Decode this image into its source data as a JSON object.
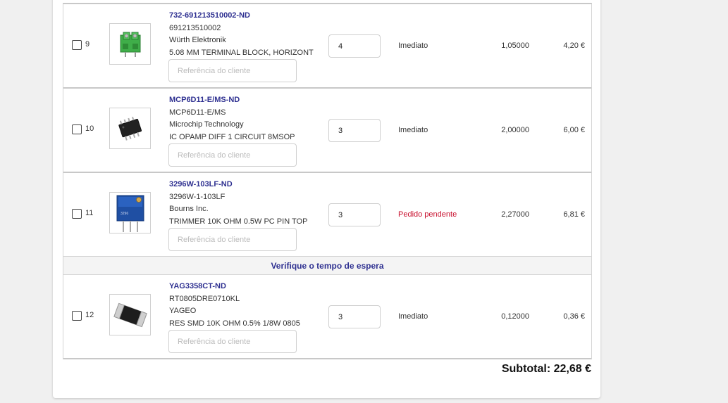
{
  "items": [
    {
      "line": "9",
      "part_number": "732-691213510002-ND",
      "mfr_part": "691213510002",
      "manufacturer": "Würth Elektronik",
      "description": "5.08 MM TERMINAL BLOCK, HORIZONT",
      "ref_placeholder": "Referência do cliente",
      "quantity": "4",
      "availability": "Imediato",
      "availability_status": "immediate",
      "unit_price": "1,05000",
      "ext_price": "4,20 €",
      "image_icon": "terminal-block-icon"
    },
    {
      "line": "10",
      "part_number": "MCP6D11-E/MS-ND",
      "mfr_part": "MCP6D11-E/MS",
      "manufacturer": "Microchip Technology",
      "description": "IC OPAMP DIFF 1 CIRCUIT 8MSOP",
      "ref_placeholder": "Referência do cliente",
      "quantity": "3",
      "availability": "Imediato",
      "availability_status": "immediate",
      "unit_price": "2,00000",
      "ext_price": "6,00 €",
      "image_icon": "ic-chip-icon"
    },
    {
      "line": "11",
      "part_number": "3296W-103LF-ND",
      "mfr_part": "3296W-1-103LF",
      "manufacturer": "Bourns Inc.",
      "description": "TRIMMER 10K OHM 0.5W PC PIN TOP",
      "ref_placeholder": "Referência do cliente",
      "quantity": "3",
      "availability": "Pedido pendente",
      "availability_status": "pending",
      "unit_price": "2,27000",
      "ext_price": "6,81 €",
      "image_icon": "trimmer-potentiometer-icon"
    },
    {
      "line": "12",
      "part_number": "YAG3358CT-ND",
      "mfr_part": "RT0805DRE0710KL",
      "manufacturer": "YAGEO",
      "description": "RES SMD 10K OHM 0.5% 1/8W 0805",
      "ref_placeholder": "Referência do cliente",
      "quantity": "3",
      "availability": "Imediato",
      "availability_status": "immediate",
      "unit_price": "0,12000",
      "ext_price": "0,36 €",
      "image_icon": "smd-resistor-icon"
    }
  ],
  "lead_time_notice": "Verifique o tempo de espera",
  "subtotal": "Subtotal: 22,68 €",
  "colors": {
    "link": "#2f3191",
    "pending": "#c8102e",
    "row_border": "#c8c8c8"
  }
}
